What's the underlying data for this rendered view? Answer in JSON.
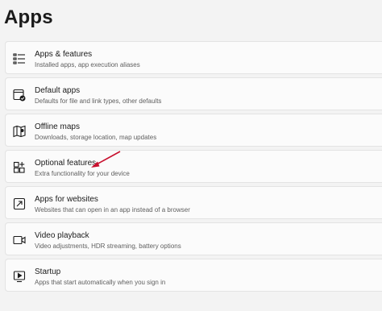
{
  "page": {
    "title": "Apps"
  },
  "items": [
    {
      "title": "Apps & features",
      "desc": "Installed apps, app execution aliases",
      "icon": "apps-list-icon"
    },
    {
      "title": "Default apps",
      "desc": "Defaults for file and link types, other defaults",
      "icon": "default-apps-icon"
    },
    {
      "title": "Offline maps",
      "desc": "Downloads, storage location, map updates",
      "icon": "map-icon"
    },
    {
      "title": "Optional features",
      "desc": "Extra functionality for your device",
      "icon": "optional-features-icon"
    },
    {
      "title": "Apps for websites",
      "desc": "Websites that can open in an app instead of a browser",
      "icon": "apps-for-websites-icon"
    },
    {
      "title": "Video playback",
      "desc": "Video adjustments, HDR streaming, battery options",
      "icon": "video-icon"
    },
    {
      "title": "Startup",
      "desc": "Apps that start automatically when you sign in",
      "icon": "startup-icon"
    }
  ],
  "annotation": {
    "color": "#c8102e"
  }
}
